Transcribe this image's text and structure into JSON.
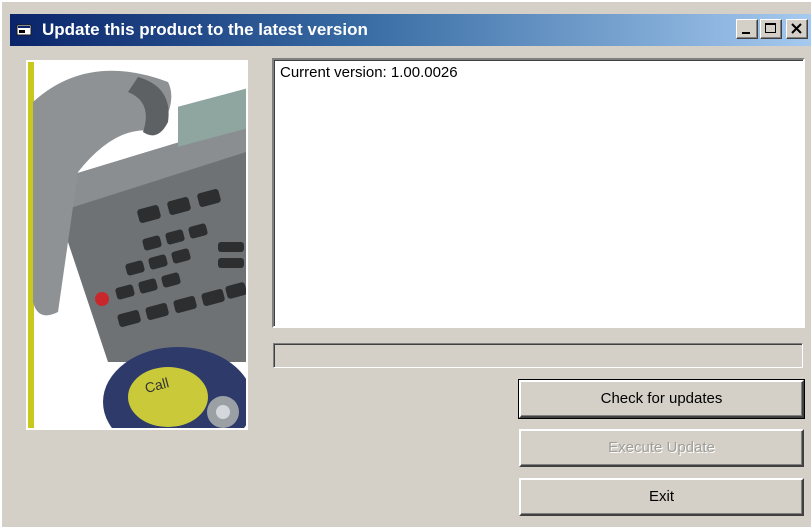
{
  "window": {
    "title": "Update this product to the latest version",
    "icon": "app-window-icon",
    "controls": [
      "minimize-icon",
      "maximize-icon",
      "close-icon"
    ]
  },
  "info": {
    "current_version_text": "Current version: 1.00.0026"
  },
  "progress": {
    "value": 0
  },
  "buttons": {
    "check": "Check for updates",
    "execute": "Execute Update",
    "exit": "Exit"
  },
  "photo_text": "Call",
  "colors": {
    "title_start": "#0a246a",
    "title_end": "#a6caf0",
    "face": "#d4d0c8",
    "accent_bar": "#c8c81e"
  }
}
